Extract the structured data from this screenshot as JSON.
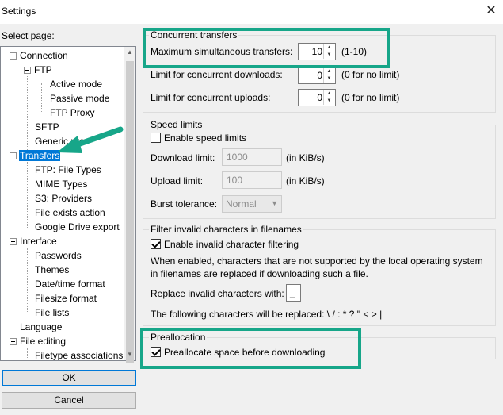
{
  "window": {
    "title": "Settings",
    "close_glyph": "✕"
  },
  "sidebar": {
    "select_page_label": "Select page:",
    "items": [
      {
        "label": "Connection"
      },
      {
        "label": "FTP"
      },
      {
        "label": "Active mode"
      },
      {
        "label": "Passive mode"
      },
      {
        "label": "FTP Proxy"
      },
      {
        "label": "SFTP"
      },
      {
        "label": "Generic prox"
      },
      {
        "label": "Transfers"
      },
      {
        "label": "FTP: File Types"
      },
      {
        "label": "MIME Types"
      },
      {
        "label": "S3: Providers"
      },
      {
        "label": "File exists action"
      },
      {
        "label": "Google Drive export"
      },
      {
        "label": "Interface"
      },
      {
        "label": "Passwords"
      },
      {
        "label": "Themes"
      },
      {
        "label": "Date/time format"
      },
      {
        "label": "Filesize format"
      },
      {
        "label": "File lists"
      },
      {
        "label": "Language"
      },
      {
        "label": "File editing"
      },
      {
        "label": "Filetype associations"
      }
    ],
    "ok_label": "OK",
    "cancel_label": "Cancel"
  },
  "concurrent": {
    "title": "Concurrent transfers",
    "max_label": "Maximum simultaneous transfers:",
    "max_value": "10",
    "max_hint": "(1-10)",
    "downloads_label": "Limit for concurrent downloads:",
    "downloads_value": "0",
    "downloads_hint": "(0 for no limit)",
    "uploads_label": "Limit for concurrent uploads:",
    "uploads_value": "0",
    "uploads_hint": "(0 for no limit)"
  },
  "speed": {
    "title": "Speed limits",
    "enable_label": "Enable speed limits",
    "enable_checked": false,
    "download_label": "Download limit:",
    "download_value": "1000",
    "download_unit": "(in KiB/s)",
    "upload_label": "Upload limit:",
    "upload_value": "100",
    "upload_unit": "(in KiB/s)",
    "burst_label": "Burst tolerance:",
    "burst_value": "Normal"
  },
  "filter": {
    "title": "Filter invalid characters in filenames",
    "enable_label": "Enable invalid character filtering",
    "enable_checked": true,
    "desc_line1": "When enabled, characters that are not supported by the local operating system",
    "desc_line2": "in filenames are replaced if downloading such a file.",
    "replace_label": "Replace invalid characters with:",
    "replace_value": "_",
    "following": "The following characters will be replaced: \\ / : * ? \" < > |"
  },
  "prealloc": {
    "title": "Preallocation",
    "checkbox_label": "Preallocate space before downloading",
    "checked": true
  },
  "colors": {
    "highlight": "#17a689",
    "selection": "#0078d7"
  }
}
